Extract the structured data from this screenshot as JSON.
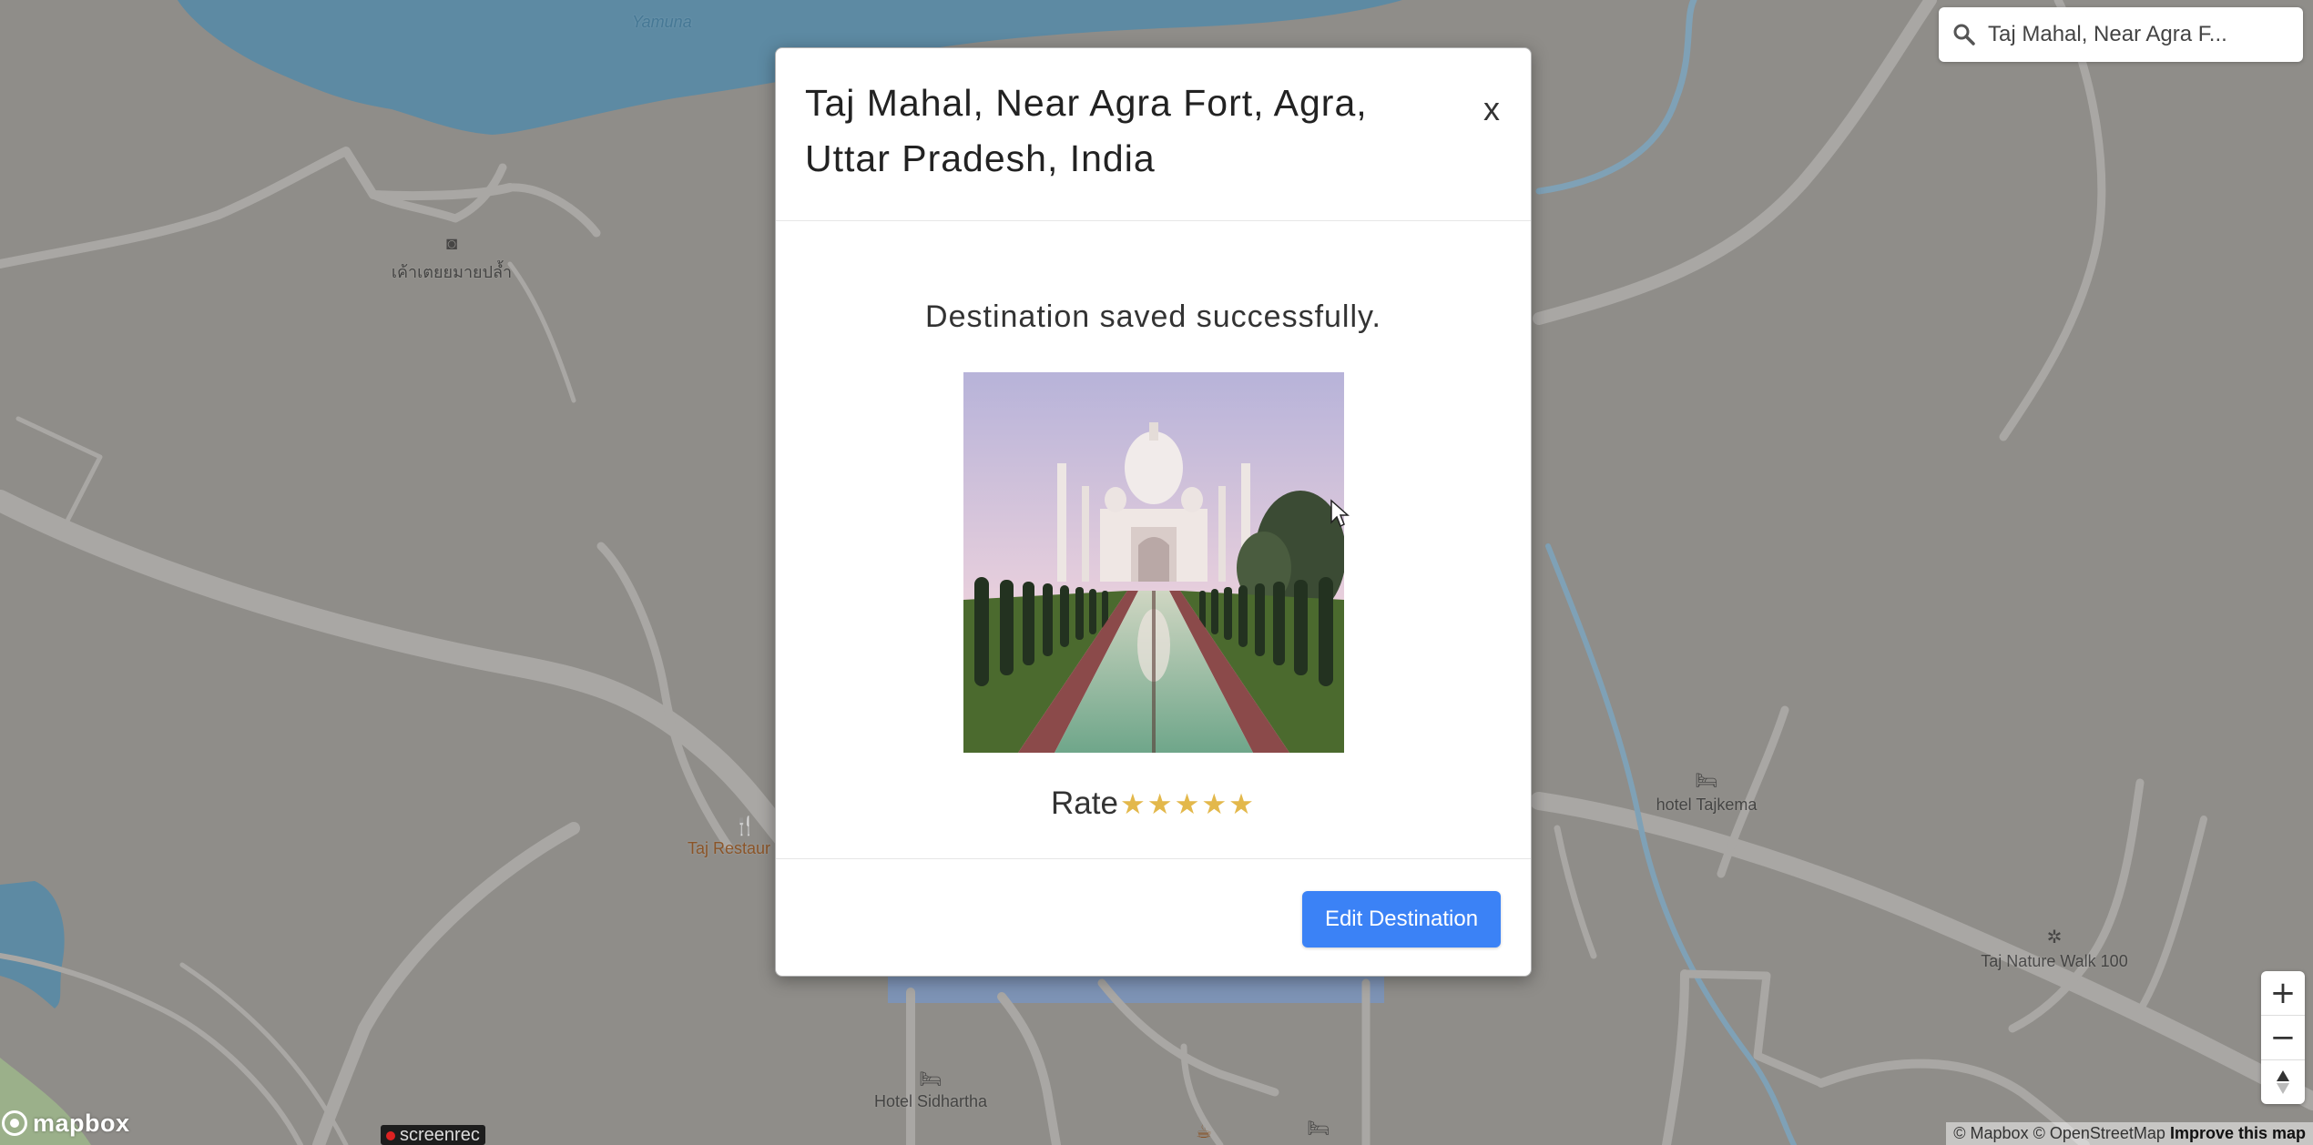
{
  "colors": {
    "land": "#8f8d89",
    "water": "#5d8aa3",
    "road": "#a9a7a4",
    "accent": "#3b82f6",
    "star": "#e3b84b",
    "park": "#9bb08a"
  },
  "map": {
    "labels": {
      "river": "Yamuna",
      "thai_camera_poi": "เค้าเตยยมายปล้ำ",
      "restaurant": "Taj Restaur",
      "hotel_tajkema": "hotel Tajkema",
      "nature_walk": "Taj Nature Walk 100",
      "hotel_sidhartha": "Hotel Sidhartha"
    },
    "icons": {
      "camera": "camera-icon",
      "restaurant": "restaurant-icon",
      "hotel": "bed-icon",
      "park": "park-icon"
    }
  },
  "search": {
    "value": "Taj Mahal, Near Agra F...",
    "icon": "search-icon"
  },
  "controls": {
    "zoom_in": "+",
    "zoom_out": "−",
    "compass": "▲"
  },
  "branding": {
    "mapbox": "mapbox",
    "screenrec": "screenrec"
  },
  "attribution": {
    "mapbox": "© Mapbox",
    "osm": "© OpenStreetMap",
    "improve": "Improve this map"
  },
  "modal": {
    "title": "Taj Mahal, Near Agra Fort, Agra, Uttar Pradesh, India",
    "close": "x",
    "success_message": "Destination saved successfully.",
    "rate_label": "Rate",
    "rating_max": 5,
    "edit_button": "Edit Destination"
  }
}
